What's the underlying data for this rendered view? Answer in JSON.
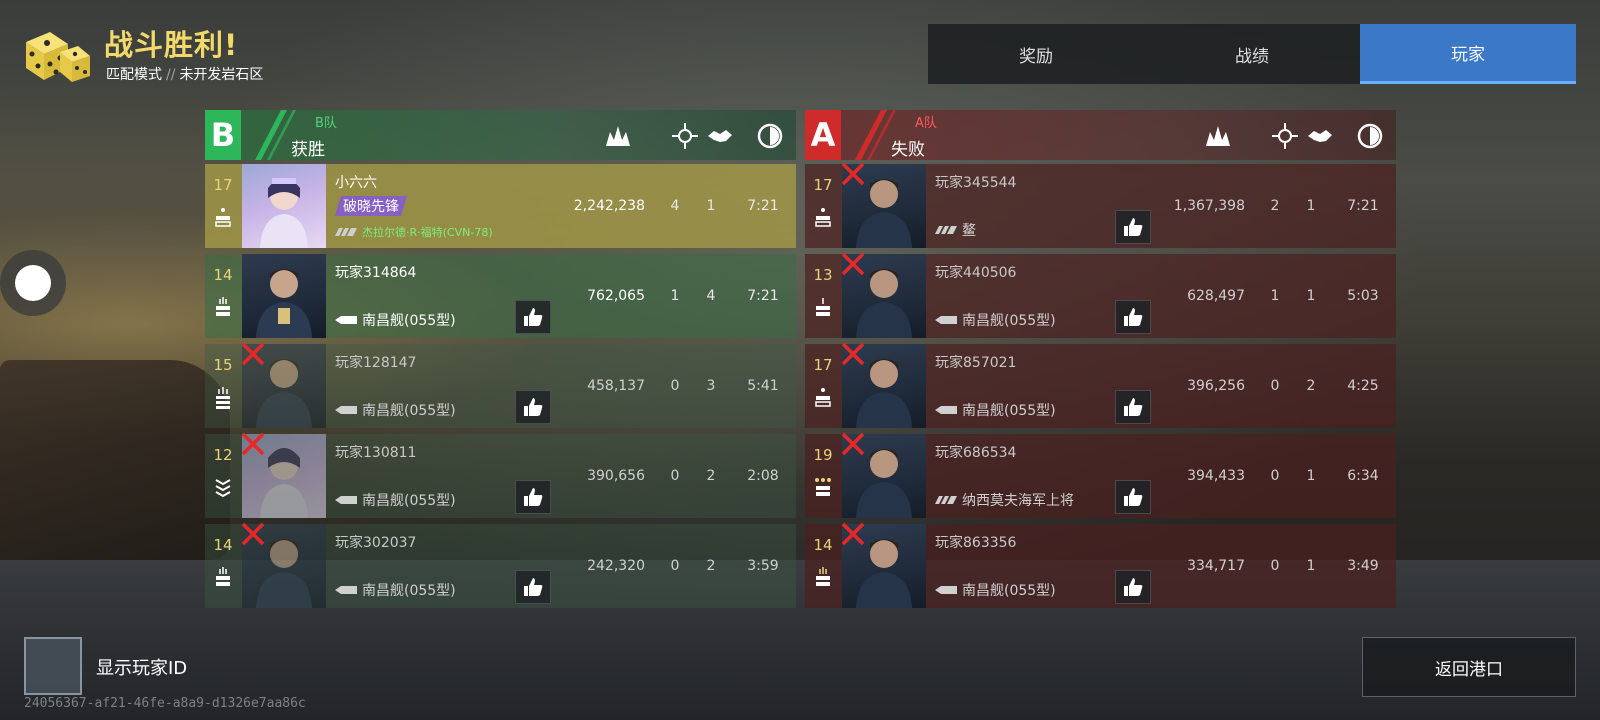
{
  "header": {
    "title": "战斗胜利!",
    "mode": "匹配模式",
    "separator": "//",
    "map": "未开发岩石区",
    "icon": "dice-icon"
  },
  "tabs": [
    {
      "label": "奖励",
      "active": false
    },
    {
      "label": "战绩",
      "active": false
    },
    {
      "label": "玩家",
      "active": true
    }
  ],
  "columns_icons": [
    "score-icon",
    "kills-icon",
    "assists-icon",
    "time-icon"
  ],
  "team_b": {
    "badge": "B",
    "name": "B队",
    "result": "获胜",
    "color": "#2db65a",
    "players": [
      {
        "level": "17",
        "name": "小六六",
        "tag": "破晓先锋",
        "ship": "杰拉尔德·R·福特(CVN-78)",
        "score": "2,242,238",
        "kills": "4",
        "assists": "1",
        "time": "7:21",
        "mvp": true,
        "dead": false,
        "portrait": "female"
      },
      {
        "level": "14",
        "name": "玩家314864",
        "ship": "南昌舰(055型)",
        "score": "762,065",
        "kills": "1",
        "assists": "4",
        "time": "7:21",
        "dead": false,
        "portrait": "male"
      },
      {
        "level": "15",
        "name": "玩家128147",
        "ship": "南昌舰(055型)",
        "score": "458,137",
        "kills": "0",
        "assists": "3",
        "time": "5:41",
        "dead": true,
        "portrait": "male"
      },
      {
        "level": "12",
        "name": "玩家130811",
        "ship": "南昌舰(055型)",
        "score": "390,656",
        "kills": "0",
        "assists": "2",
        "time": "2:08",
        "dead": true,
        "portrait": "female"
      },
      {
        "level": "14",
        "name": "玩家302037",
        "ship": "南昌舰(055型)",
        "score": "242,320",
        "kills": "0",
        "assists": "2",
        "time": "3:59",
        "dead": true,
        "portrait": "male"
      }
    ]
  },
  "team_a": {
    "badge": "A",
    "name": "A队",
    "result": "失败",
    "color": "#d02b2b",
    "players": [
      {
        "level": "17",
        "name": "玩家345544",
        "ship": "鳌",
        "score": "1,367,398",
        "kills": "2",
        "assists": "1",
        "time": "7:21",
        "dead": true,
        "portrait": "male"
      },
      {
        "level": "13",
        "name": "玩家440506",
        "ship": "南昌舰(055型)",
        "score": "628,497",
        "kills": "1",
        "assists": "1",
        "time": "5:03",
        "dead": true,
        "portrait": "male"
      },
      {
        "level": "17",
        "name": "玩家857021",
        "ship": "南昌舰(055型)",
        "score": "396,256",
        "kills": "0",
        "assists": "2",
        "time": "4:25",
        "dead": true,
        "portrait": "male"
      },
      {
        "level": "19",
        "name": "玩家686534",
        "ship": "纳西莫夫海军上将",
        "score": "394,433",
        "kills": "0",
        "assists": "1",
        "time": "6:34",
        "dead": true,
        "portrait": "male"
      },
      {
        "level": "14",
        "name": "玩家863356",
        "ship": "南昌舰(055型)",
        "score": "334,717",
        "kills": "0",
        "assists": "1",
        "time": "3:49",
        "dead": true,
        "portrait": "male"
      }
    ]
  },
  "footer": {
    "show_id_label": "显示玩家ID",
    "show_id_checked": false,
    "uid": "24056367-af21-46fe-a8a9-d1326e7aa86c",
    "back_label": "返回港口"
  }
}
